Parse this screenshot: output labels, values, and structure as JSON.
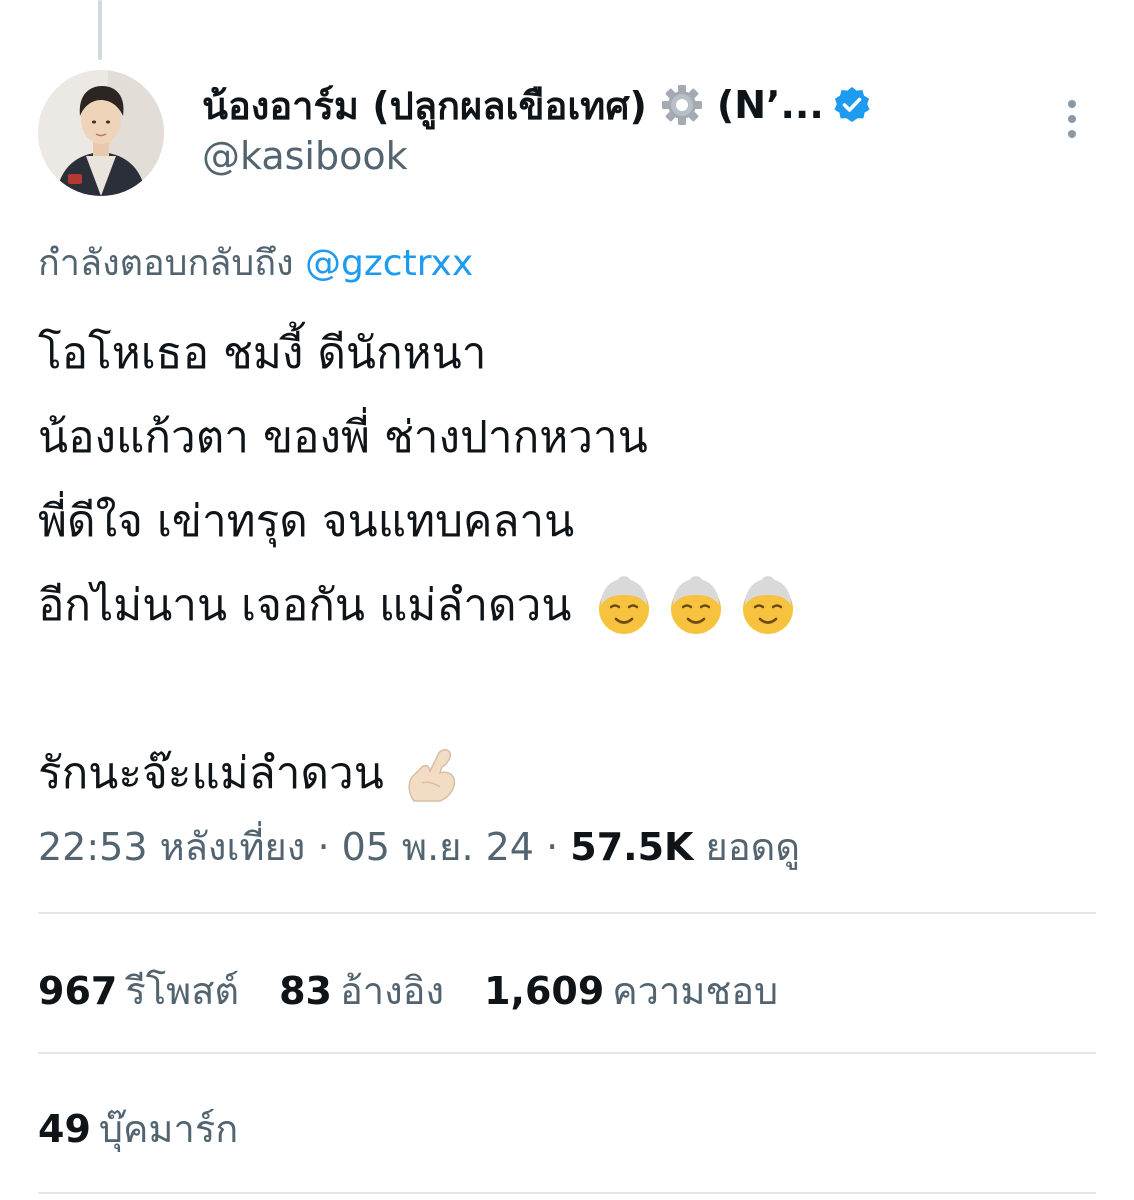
{
  "tweet": {
    "author": {
      "display_name": "น้องอาร์ม (ปลูกผลเขือเทศ)",
      "name_suffix": "(N’...",
      "handle": "@kasibook",
      "verified": true,
      "badge_icon": "gear-icon"
    },
    "reply_to": {
      "prefix": "กำลังตอบกลับถึง",
      "mention": "@gzctrxx"
    },
    "lines": [
      "โอโหเธอ ชมงี้ ดีนักหนา",
      "น้องแก้วตา ของพี่ ช่างปากหวาน",
      "พี่ดีใจ เข่าทรุด จนแทบคลาน",
      "อีกไม่นาน เจอกัน แม่ลำดวน",
      "",
      "รักนะจ๊ะแม่ลำดวน"
    ],
    "time": "22:53 หลังเที่ยง",
    "separator": "·",
    "date": "05 พ.ย. 24",
    "views": "57.5K",
    "views_label": "ยอดดู"
  },
  "stats": {
    "retweets": "967",
    "retweets_label": "รีโพสต์",
    "quotes": "83",
    "quotes_label": "อ้างอิง",
    "likes": "1,609",
    "likes_label": "ความชอบ",
    "bookmarks": "49",
    "bookmarks_label": "บุ๊คมาร์ก"
  },
  "colors": {
    "link": "#1d9bf0",
    "secondary_text": "#536471",
    "primary_text": "#0f1419",
    "divider": "#e1e6ea"
  }
}
